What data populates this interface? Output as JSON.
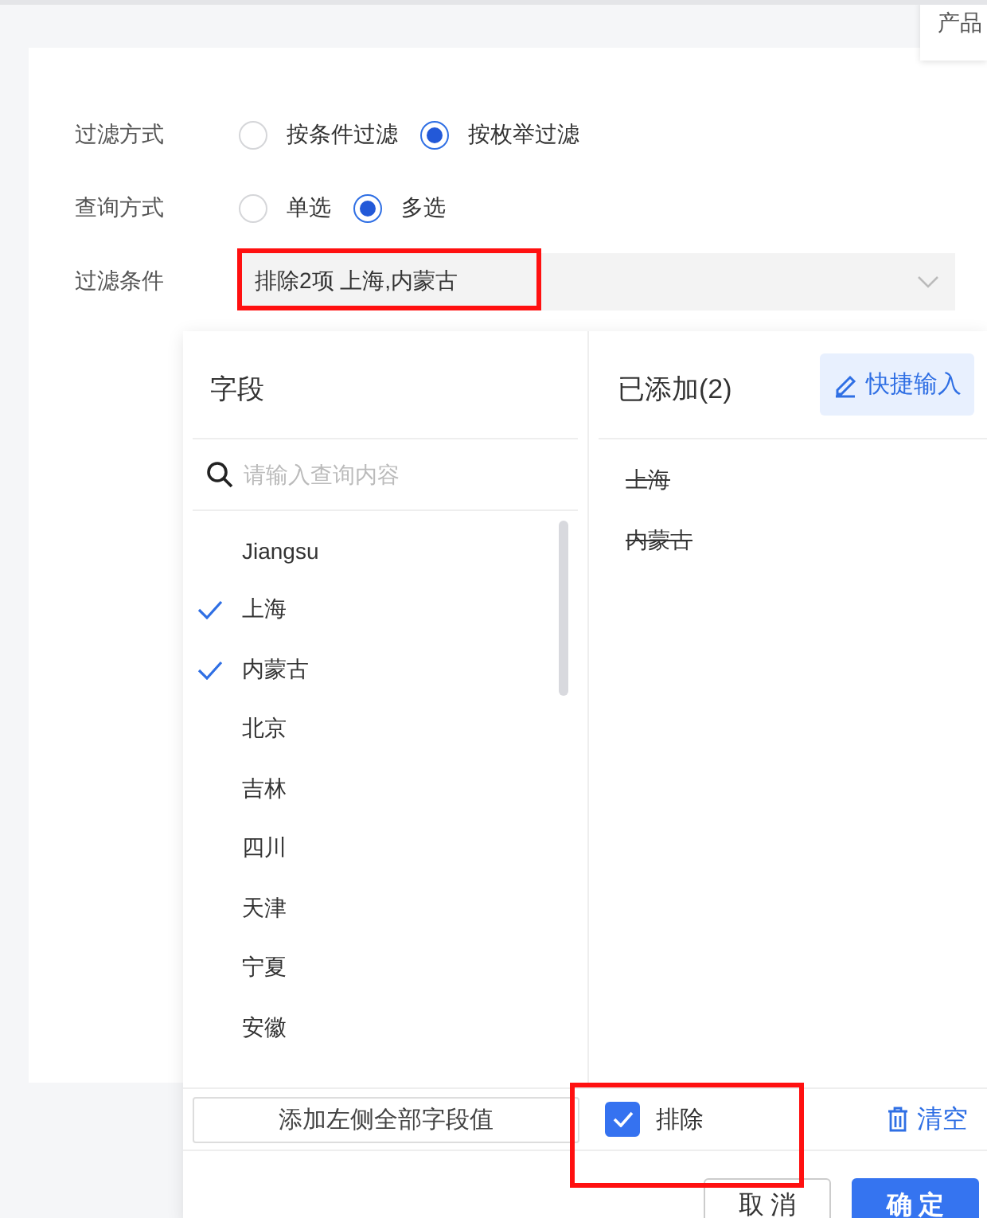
{
  "tooltip": "产品",
  "form": {
    "rows": [
      {
        "label": "过滤方式",
        "kind": "radio",
        "options": [
          {
            "label": "按条件过滤",
            "selected": false
          },
          {
            "label": "按枚举过滤",
            "selected": true
          }
        ]
      },
      {
        "label": "查询方式",
        "kind": "radio",
        "options": [
          {
            "label": "单选",
            "selected": false
          },
          {
            "label": "多选",
            "selected": true
          }
        ]
      },
      {
        "label": "过滤条件",
        "kind": "select",
        "value": "排除2项 上海,内蒙古",
        "highlighted": true
      }
    ]
  },
  "picker": {
    "fields_title": "字段",
    "search": {
      "placeholder": "请输入查询内容"
    },
    "fields": [
      {
        "label": "Jiangsu",
        "checked": false
      },
      {
        "label": "上海",
        "checked": true
      },
      {
        "label": "内蒙古",
        "checked": true
      },
      {
        "label": "北京",
        "checked": false
      },
      {
        "label": "吉林",
        "checked": false
      },
      {
        "label": "四川",
        "checked": false
      },
      {
        "label": "天津",
        "checked": false
      },
      {
        "label": "宁夏",
        "checked": false
      },
      {
        "label": "安徽",
        "checked": false
      }
    ],
    "added_title": "已添加(2)",
    "quick_input": "快捷输入",
    "added": [
      "上海",
      "内蒙古"
    ],
    "add_all": "添加左侧全部字段值",
    "exclude": {
      "label": "排除",
      "checked": true,
      "highlighted": true
    },
    "clear": "清空"
  },
  "buttons": [
    {
      "label": "取 消",
      "kind": "secondary"
    },
    {
      "label": "确 定",
      "kind": "primary"
    }
  ]
}
